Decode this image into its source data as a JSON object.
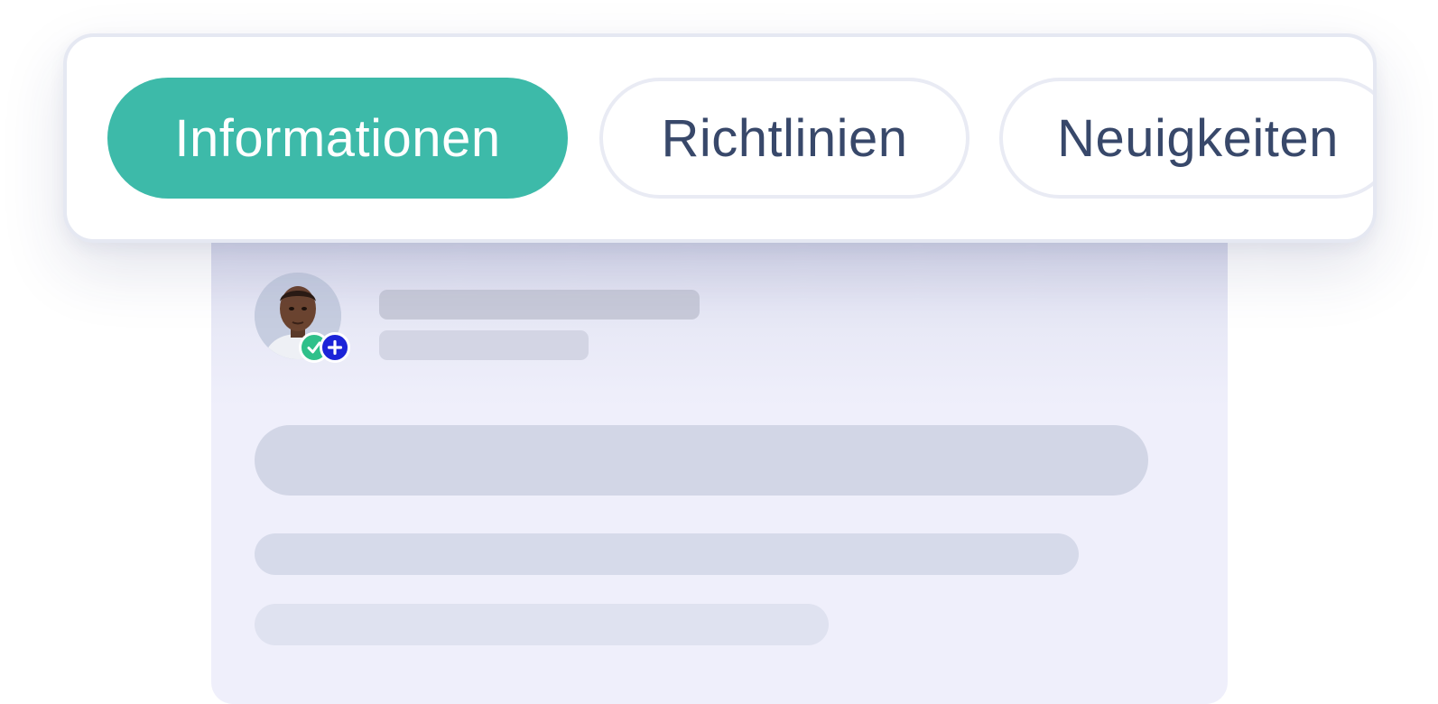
{
  "tabs": [
    {
      "label": "Informationen",
      "active": true
    },
    {
      "label": "Richtlinien",
      "active": false
    },
    {
      "label": "Neuigkeiten",
      "active": false
    }
  ],
  "profile": {
    "avatar": "person-photo",
    "badges": [
      "check-icon",
      "plus-icon"
    ]
  },
  "colors": {
    "accent": "#3dbaa9",
    "tab_text": "#38486a",
    "badge_check": "#2fc08a",
    "badge_plus": "#1c24d8"
  }
}
